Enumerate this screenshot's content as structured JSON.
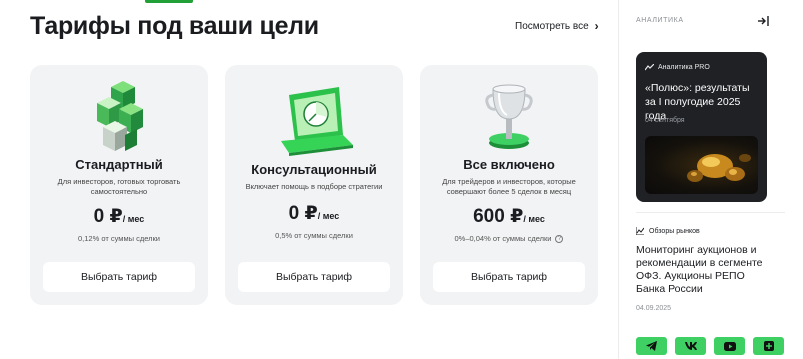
{
  "header": {
    "title": "Тарифы под ваши цели",
    "see_all": "Посмотреть все"
  },
  "tariffs": [
    {
      "name": "Стандартный",
      "description": "Для инвесторов, готовых торговать самостоятельно",
      "price": "0 ₽",
      "period": "/ мес",
      "fee": "0,12% от суммы сделки",
      "button": "Выбрать тариф",
      "icon": "cubes-icon"
    },
    {
      "name": "Консультационный",
      "description": "Включает помощь в подборе стратегии",
      "price": "0 ₽",
      "period": "/ мес",
      "fee": "0,5% от суммы сделки",
      "button": "Выбрать тариф",
      "icon": "laptop-chart-icon"
    },
    {
      "name": "Все включено",
      "description": "Для трейдеров и инвесторов, которые совершают более 5 сделок в месяц",
      "price": "600 ₽",
      "period": "/ мес",
      "fee": "0%–0,04% от суммы сделки",
      "button": "Выбрать тариф",
      "icon": "trophy-icon"
    }
  ],
  "sidebar": {
    "header": "АНАЛИТИКА",
    "featured": {
      "tag": "Аналитика PRO",
      "title": "«Полюс»: результаты за I полугодие 2025 года",
      "date": "04 сентября"
    },
    "review": {
      "tag": "Обзоры рынков",
      "title": "Мониторинг аукционов и рекомендации в сегменте ОФЗ. Аукционы РЕПО Банка России",
      "date": "04.09.2025"
    },
    "socials": [
      "telegram-icon",
      "vk-icon",
      "youtube-icon",
      "plus-icon"
    ]
  },
  "colors": {
    "accent": "#21a038",
    "social_green": "#3ed063",
    "card_bg": "#f2f3f5",
    "dark_card": "#1f2125"
  }
}
